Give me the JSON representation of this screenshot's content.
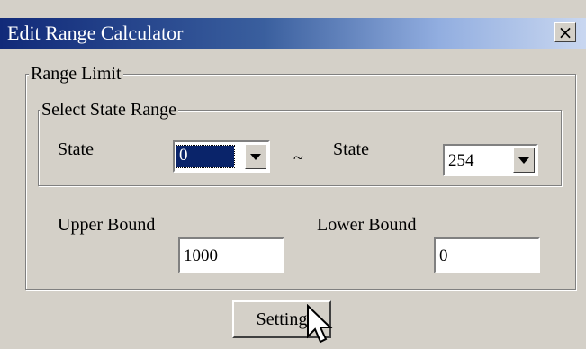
{
  "window": {
    "title": "Edit Range Calculator",
    "close_label": "×"
  },
  "range_limit": {
    "legend": "Range Limit",
    "state_range": {
      "legend": "Select State Range",
      "from_label": "State",
      "from_value": "0",
      "separator": "~",
      "to_label": "State",
      "to_value": "254"
    },
    "upper_bound": {
      "label": "Upper Bound",
      "value": "1000"
    },
    "lower_bound": {
      "label": "Lower Bound",
      "value": "0"
    }
  },
  "buttons": {
    "setting_label": "Setting"
  },
  "icons": {
    "close": "close-icon",
    "dropdown": "chevron-down-icon",
    "cursor": "mouse-pointer-icon"
  },
  "colors": {
    "dialog_bg": "#d4d0c8",
    "title_start": "#112a79",
    "title_end": "#c9d7f0",
    "selection": "#0a246a"
  }
}
